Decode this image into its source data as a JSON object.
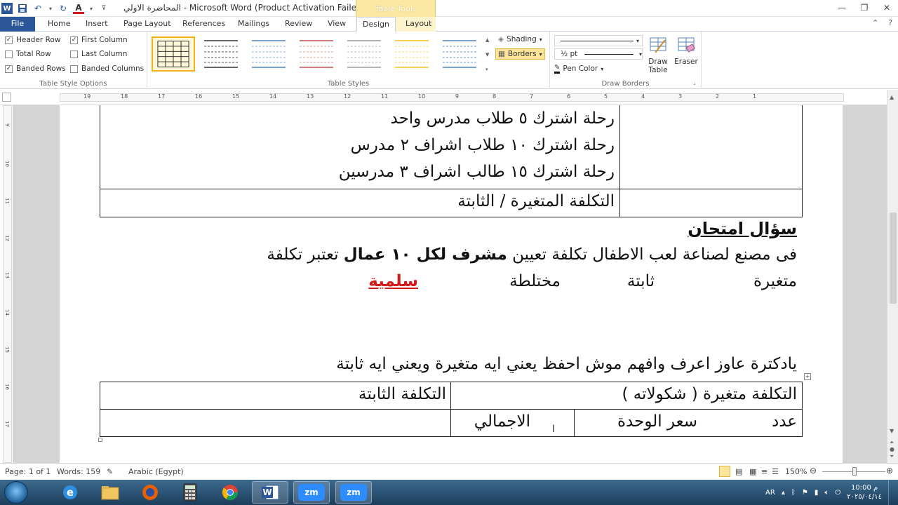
{
  "titlebar": {
    "title": "المحاضرة الاولي  -  Microsoft Word (Product Activation Failed)",
    "context_tab": "Table Tools",
    "app_icon": "W"
  },
  "tabs": {
    "file": "File",
    "items": [
      "Home",
      "Insert",
      "Page Layout",
      "References",
      "Mailings",
      "Review",
      "View",
      "Design",
      "Layout"
    ],
    "active": "Design"
  },
  "ribbon": {
    "style_options": {
      "label": "Table Style Options",
      "header_row": "Header Row",
      "total_row": "Total Row",
      "banded_rows": "Banded Rows",
      "first_column": "First Column",
      "last_column": "Last Column",
      "banded_columns": "Banded Columns"
    },
    "styles": {
      "label": "Table Styles",
      "swatches": [
        "#222222",
        "#333333",
        "#4f81bd",
        "#c0504d",
        "#9bbb59",
        "#f2c21f",
        "#4f81bd"
      ]
    },
    "shading": "Shading",
    "borders": "Borders",
    "pen_weight": "½ pt",
    "pen_color": "Pen Color",
    "draw_table": "Draw Table",
    "eraser": "Eraser",
    "draw_borders_label": "Draw Borders"
  },
  "ruler": {
    "numbers": [
      "19",
      "18",
      "17",
      "16",
      "15",
      "14",
      "13",
      "12",
      "11",
      "10",
      "9",
      "8",
      "7",
      "6",
      "5",
      "4",
      "3",
      "2",
      "1"
    ],
    "vnumbers": [
      "9",
      "10",
      "11",
      "12",
      "13",
      "14",
      "15",
      "16",
      "17"
    ]
  },
  "document": {
    "table1_lines": [
      "رحلة اشترك ٥ طلاب  مدرس واحد",
      "رحلة اشترك ١٠ طلاب اشراف ٢ مدرس",
      "رحلة اشترك ١٥ طالب اشراف ٣ مدرسين"
    ],
    "table1_row2": "التكلفة المتغيرة / الثابتة",
    "heading": "سؤال امتحان",
    "para1_a": "فى مصنع لصناعة لعب الاطفال تكلفة تعيين ",
    "para1_bold": "مشرف لكل ١٠ عمال",
    "para1_b": " تعتبر تكلفة",
    "options": [
      "متغيرة",
      "ثابتة",
      "مختلطة",
      "سلمية"
    ],
    "para2": "يادكترة عاوز اعرف وافهم موش احفظ يعني ايه متغيرة ويعني ايه ثابتة",
    "table2": {
      "header_right": "التكلفة متغيرة ( شكولاته )",
      "header_left": "التكلفة الثابتة",
      "row2_a": "عدد",
      "row2_b": "سعر الوحدة",
      "row2_c": "الاجمالي"
    }
  },
  "statusbar": {
    "page": "Page: 1 of 1",
    "words": "Words: 159",
    "language": "Arabic (Egypt)",
    "zoom": "150%"
  },
  "taskbar": {
    "lang": "AR",
    "time": "10:00 م",
    "date": "٢٠٢٥/٠٤/١٤",
    "apps": [
      "ie",
      "explorer",
      "firefox",
      "calculator",
      "chrome",
      "word",
      "zoom",
      "zoom"
    ],
    "zoom_label": "zm"
  },
  "colors": {
    "accent": "#2b579a",
    "context_tab": "#fbe8a2",
    "red_text": "#d11a1a"
  }
}
